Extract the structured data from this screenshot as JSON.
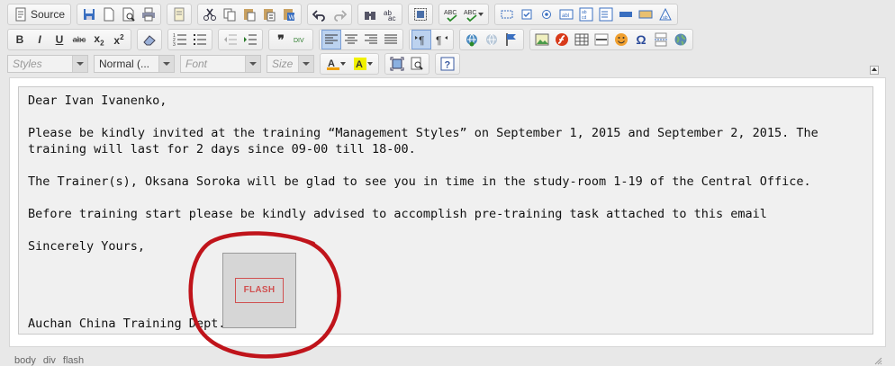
{
  "toolbar": {
    "source_label": "Source",
    "styles_placeholder": "Styles",
    "format_value": "Normal (...",
    "font_placeholder": "Font",
    "size_placeholder": "Size"
  },
  "editor": {
    "greeting": "Dear Ivan Ivanenko,",
    "para1": "Please be kindly invited at the training “Management Styles” on September 1, 2015 and September 2, 2015. The training will last for 2 days since 09-00 till 18-00.",
    "para2": "The Trainer(s), Oksana Soroka will be glad to see you in time in the study-room 1-19 of the Central Office.",
    "para3": "Before training start please be kindly advised to accomplish pre-training task attached to this email",
    "closing": "Sincerely Yours,",
    "signature": "Auchan China Training Dept.",
    "flash_label": "FLASH"
  },
  "statusbar": {
    "path": [
      "body",
      "div",
      "flash"
    ]
  },
  "colors": {
    "annotation": "#c0141b",
    "flash_border": "#d05050"
  }
}
